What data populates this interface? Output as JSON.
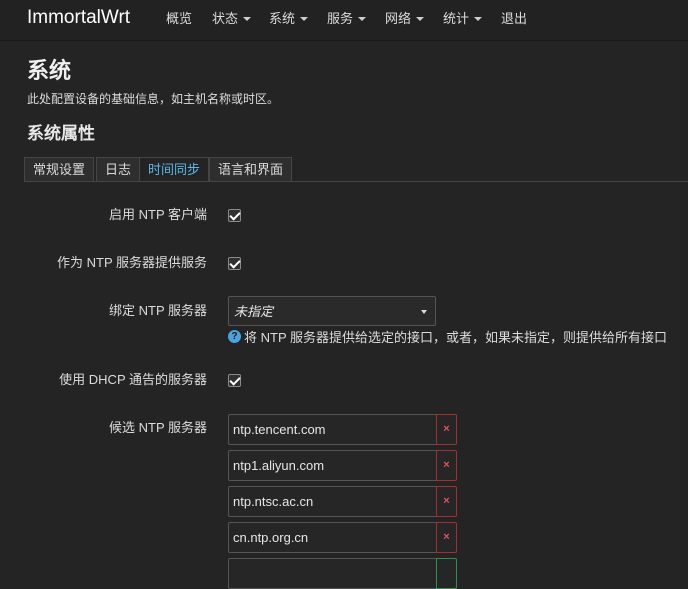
{
  "brand": "ImmortalWrt",
  "nav": [
    {
      "label": "概览",
      "dropdown": false
    },
    {
      "label": "状态",
      "dropdown": true
    },
    {
      "label": "系统",
      "dropdown": true
    },
    {
      "label": "服务",
      "dropdown": true
    },
    {
      "label": "网络",
      "dropdown": true
    },
    {
      "label": "统计",
      "dropdown": true
    },
    {
      "label": "退出",
      "dropdown": false
    }
  ],
  "page": {
    "title": "系统",
    "description": "此处配置设备的基础信息，如主机名称或时区。"
  },
  "section": {
    "title": "系统属性"
  },
  "tabs": [
    {
      "label": "常规设置",
      "active": false
    },
    {
      "label": "日志",
      "active": false
    },
    {
      "label": "时间同步",
      "active": true
    },
    {
      "label": "语言和界面",
      "active": false
    }
  ],
  "form": {
    "enable_ntp_client": {
      "label": "启用 NTP 客户端",
      "checked": true
    },
    "provide_ntp_server": {
      "label": "作为 NTP 服务器提供服务",
      "checked": true
    },
    "bind_ntp_server": {
      "label": "绑定 NTP 服务器",
      "value": "未指定",
      "help": "将 NTP 服务器提供给选定的接口，或者，如果未指定，则提供给所有接口"
    },
    "use_dhcp_servers": {
      "label": "使用 DHCP 通告的服务器",
      "checked": true
    },
    "candidate_servers": {
      "label": "候选 NTP 服务器",
      "items": [
        "ntp.tencent.com",
        "ntp1.aliyun.com",
        "ntp.ntsc.ac.cn",
        "cn.ntp.org.cn"
      ],
      "remove_glyph": "×"
    }
  },
  "colors": {
    "background": "#242424",
    "navbar": "#222222",
    "active_tab": "#5bb8e8",
    "remove": "#e05555",
    "add": "#2f8f4e",
    "help": "#4aa3df"
  }
}
